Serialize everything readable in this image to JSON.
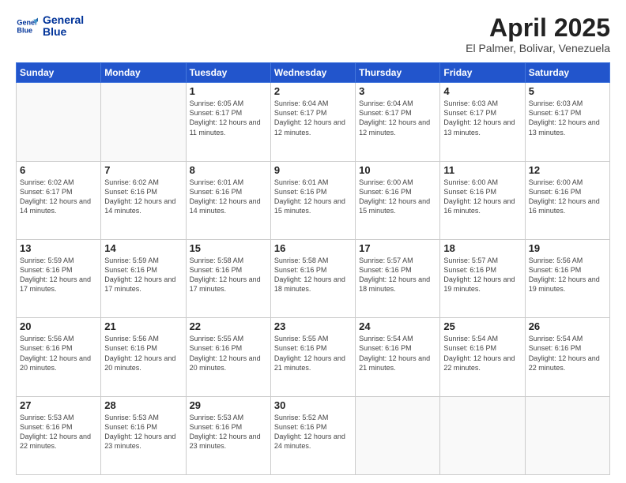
{
  "header": {
    "logo_line1": "General",
    "logo_line2": "Blue",
    "title": "April 2025",
    "location": "El Palmer, Bolivar, Venezuela"
  },
  "days_of_week": [
    "Sunday",
    "Monday",
    "Tuesday",
    "Wednesday",
    "Thursday",
    "Friday",
    "Saturday"
  ],
  "weeks": [
    [
      {
        "day": "",
        "info": ""
      },
      {
        "day": "",
        "info": ""
      },
      {
        "day": "1",
        "info": "Sunrise: 6:05 AM\nSunset: 6:17 PM\nDaylight: 12 hours and 11 minutes."
      },
      {
        "day": "2",
        "info": "Sunrise: 6:04 AM\nSunset: 6:17 PM\nDaylight: 12 hours and 12 minutes."
      },
      {
        "day": "3",
        "info": "Sunrise: 6:04 AM\nSunset: 6:17 PM\nDaylight: 12 hours and 12 minutes."
      },
      {
        "day": "4",
        "info": "Sunrise: 6:03 AM\nSunset: 6:17 PM\nDaylight: 12 hours and 13 minutes."
      },
      {
        "day": "5",
        "info": "Sunrise: 6:03 AM\nSunset: 6:17 PM\nDaylight: 12 hours and 13 minutes."
      }
    ],
    [
      {
        "day": "6",
        "info": "Sunrise: 6:02 AM\nSunset: 6:17 PM\nDaylight: 12 hours and 14 minutes."
      },
      {
        "day": "7",
        "info": "Sunrise: 6:02 AM\nSunset: 6:16 PM\nDaylight: 12 hours and 14 minutes."
      },
      {
        "day": "8",
        "info": "Sunrise: 6:01 AM\nSunset: 6:16 PM\nDaylight: 12 hours and 14 minutes."
      },
      {
        "day": "9",
        "info": "Sunrise: 6:01 AM\nSunset: 6:16 PM\nDaylight: 12 hours and 15 minutes."
      },
      {
        "day": "10",
        "info": "Sunrise: 6:00 AM\nSunset: 6:16 PM\nDaylight: 12 hours and 15 minutes."
      },
      {
        "day": "11",
        "info": "Sunrise: 6:00 AM\nSunset: 6:16 PM\nDaylight: 12 hours and 16 minutes."
      },
      {
        "day": "12",
        "info": "Sunrise: 6:00 AM\nSunset: 6:16 PM\nDaylight: 12 hours and 16 minutes."
      }
    ],
    [
      {
        "day": "13",
        "info": "Sunrise: 5:59 AM\nSunset: 6:16 PM\nDaylight: 12 hours and 17 minutes."
      },
      {
        "day": "14",
        "info": "Sunrise: 5:59 AM\nSunset: 6:16 PM\nDaylight: 12 hours and 17 minutes."
      },
      {
        "day": "15",
        "info": "Sunrise: 5:58 AM\nSunset: 6:16 PM\nDaylight: 12 hours and 17 minutes."
      },
      {
        "day": "16",
        "info": "Sunrise: 5:58 AM\nSunset: 6:16 PM\nDaylight: 12 hours and 18 minutes."
      },
      {
        "day": "17",
        "info": "Sunrise: 5:57 AM\nSunset: 6:16 PM\nDaylight: 12 hours and 18 minutes."
      },
      {
        "day": "18",
        "info": "Sunrise: 5:57 AM\nSunset: 6:16 PM\nDaylight: 12 hours and 19 minutes."
      },
      {
        "day": "19",
        "info": "Sunrise: 5:56 AM\nSunset: 6:16 PM\nDaylight: 12 hours and 19 minutes."
      }
    ],
    [
      {
        "day": "20",
        "info": "Sunrise: 5:56 AM\nSunset: 6:16 PM\nDaylight: 12 hours and 20 minutes."
      },
      {
        "day": "21",
        "info": "Sunrise: 5:56 AM\nSunset: 6:16 PM\nDaylight: 12 hours and 20 minutes."
      },
      {
        "day": "22",
        "info": "Sunrise: 5:55 AM\nSunset: 6:16 PM\nDaylight: 12 hours and 20 minutes."
      },
      {
        "day": "23",
        "info": "Sunrise: 5:55 AM\nSunset: 6:16 PM\nDaylight: 12 hours and 21 minutes."
      },
      {
        "day": "24",
        "info": "Sunrise: 5:54 AM\nSunset: 6:16 PM\nDaylight: 12 hours and 21 minutes."
      },
      {
        "day": "25",
        "info": "Sunrise: 5:54 AM\nSunset: 6:16 PM\nDaylight: 12 hours and 22 minutes."
      },
      {
        "day": "26",
        "info": "Sunrise: 5:54 AM\nSunset: 6:16 PM\nDaylight: 12 hours and 22 minutes."
      }
    ],
    [
      {
        "day": "27",
        "info": "Sunrise: 5:53 AM\nSunset: 6:16 PM\nDaylight: 12 hours and 22 minutes."
      },
      {
        "day": "28",
        "info": "Sunrise: 5:53 AM\nSunset: 6:16 PM\nDaylight: 12 hours and 23 minutes."
      },
      {
        "day": "29",
        "info": "Sunrise: 5:53 AM\nSunset: 6:16 PM\nDaylight: 12 hours and 23 minutes."
      },
      {
        "day": "30",
        "info": "Sunrise: 5:52 AM\nSunset: 6:16 PM\nDaylight: 12 hours and 24 minutes."
      },
      {
        "day": "",
        "info": ""
      },
      {
        "day": "",
        "info": ""
      },
      {
        "day": "",
        "info": ""
      }
    ]
  ]
}
